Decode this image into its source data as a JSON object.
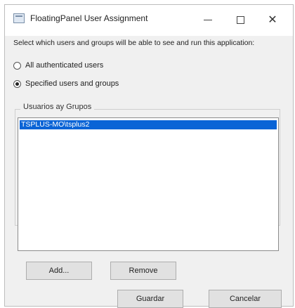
{
  "window": {
    "title": "FloatingPanel User Assignment",
    "controls": {
      "minimize": "—",
      "maximize": "□",
      "close": "✕"
    }
  },
  "description": "Select which users and groups will be able to see and run this application:",
  "options": [
    {
      "label": "All authenticated users",
      "checked": false
    },
    {
      "label": "Specified users and groups",
      "checked": true
    }
  ],
  "group_box": {
    "legend": "Usuarios ay Grupos",
    "items": [
      {
        "label": "TSPLUS-MO\\tsplus2",
        "selected": true
      }
    ]
  },
  "buttons": {
    "add": "Add...",
    "remove": "Remove",
    "save": "Guardar",
    "cancel": "Cancelar"
  },
  "colors": {
    "selection": "#0a64d6",
    "window_bg": "#f0f0f0"
  },
  "icons": {
    "app": "floating-panel-app-icon"
  }
}
